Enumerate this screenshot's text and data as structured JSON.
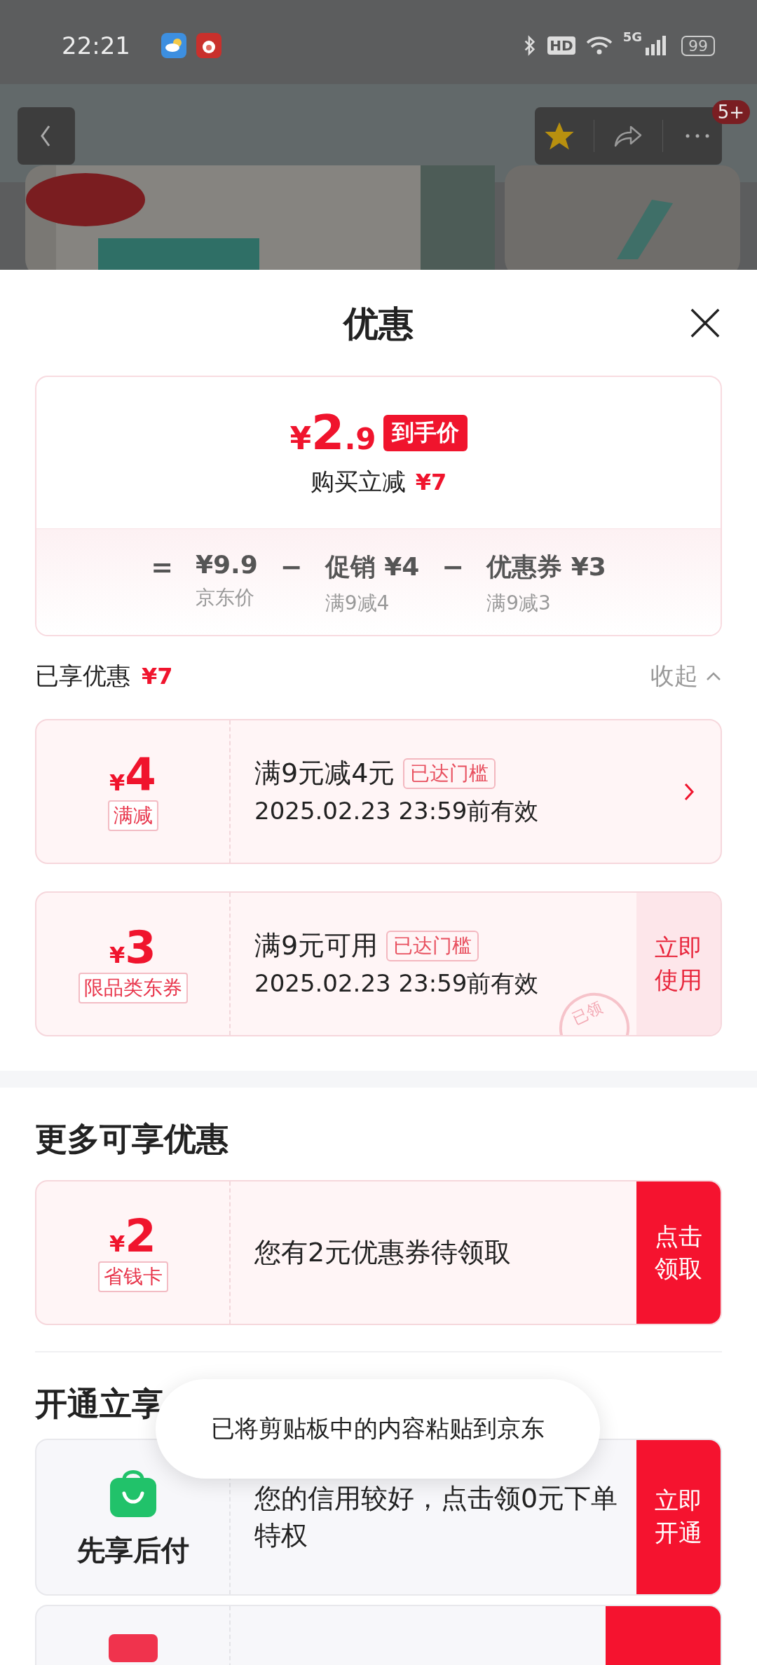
{
  "status_bar": {
    "time": "22:21",
    "hd": "HD",
    "network": "5G",
    "battery": "99"
  },
  "nav": {
    "badge": "5+",
    "favorited": true
  },
  "sheet": {
    "title": "优惠"
  },
  "summary": {
    "currency": "¥",
    "price_int": "2",
    "price_dec": ".9",
    "price_tag": "到手价",
    "saving_label": "购买立减",
    "saving": "¥7",
    "breakdown": [
      {
        "operator": "=",
        "value": "¥9.9",
        "label": "京东价"
      },
      {
        "operator": "−",
        "value": "促销 ¥4",
        "label": "满9减4"
      },
      {
        "operator": "−",
        "value": "优惠券 ¥3",
        "label": "满9减3"
      }
    ]
  },
  "applied": {
    "title": "已享优惠",
    "amount": "¥7",
    "toggle": "收起",
    "expanded": true,
    "coupons": [
      {
        "kind": "coupon",
        "currency": "¥",
        "amount": "4",
        "tag": "满减",
        "title": "满9元减4元",
        "badge": "已达门槛",
        "validity": "2025.02.23 23:59前有效",
        "action": {
          "kind": "chevron"
        }
      },
      {
        "kind": "coupon",
        "currency": "¥",
        "amount": "3",
        "tag": "限品类东券",
        "title": "满9元可用",
        "badge": "已达门槛",
        "validity": "2025.02.23 23:59前有效",
        "stamp": "已领",
        "action": {
          "kind": "light",
          "label": "立即使用"
        }
      }
    ]
  },
  "more": {
    "title": "更多可享优惠",
    "coupons": [
      {
        "kind": "coupon",
        "currency": "¥",
        "amount": "2",
        "tag": "省钱卡",
        "title": "您有2元优惠券待领取",
        "action": {
          "kind": "solid",
          "label": "点击领取"
        }
      }
    ]
  },
  "services": {
    "title": "开通立享",
    "cards": [
      {
        "kind": "service",
        "name": "先享后付",
        "text": "您的信用较好，点击领0元下单特权",
        "action": {
          "kind": "solid",
          "label": "立即开通"
        }
      },
      {
        "kind": "cut",
        "action": {
          "kind": "solid"
        }
      }
    ]
  },
  "toast": "已将剪贴板中的内容粘贴到京东"
}
